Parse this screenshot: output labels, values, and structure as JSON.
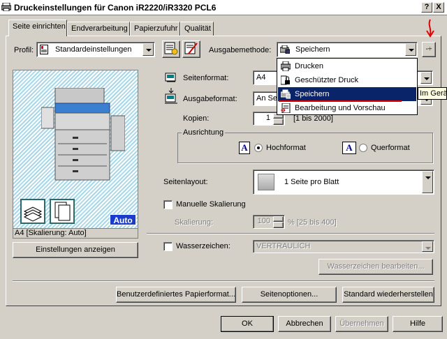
{
  "window": {
    "title": "Druckeinstellungen für Canon iR2220/iR3320 PCL6",
    "help_btn": "?",
    "close_btn": "X"
  },
  "tabs": [
    "Seite einrichten",
    "Endverarbeitung",
    "Papierzufuhr",
    "Qualität"
  ],
  "profil": {
    "label": "Profil:",
    "value": "Standardeinstellungen"
  },
  "ausgabemethode": {
    "label": "Ausgabemethode:",
    "value": "Speichern",
    "side_btn": "-÷"
  },
  "menu": {
    "items": [
      "Drucken",
      "Geschützter Druck",
      "Speichern",
      "Bearbeitung und Vorschau"
    ],
    "selected": "Speichern",
    "tooltip": "Im Gerä"
  },
  "seitenformat": {
    "label": "Seitenformat:",
    "value": "A4"
  },
  "ausgabeformat": {
    "label": "Ausgabeformat:",
    "value": "An Se"
  },
  "kopien": {
    "label": "Kopien:",
    "value": "1",
    "range": "[1 bis 2000]"
  },
  "ausrichtung": {
    "label": "Ausrichtung",
    "hoch": "Hochformat",
    "quer": "Querformat",
    "icon_letter": "A"
  },
  "seitenlayout": {
    "label": "Seitenlayout:",
    "value": "1 Seite pro Blatt"
  },
  "manuelle_skalierung": {
    "label": "Manuelle Skalierung"
  },
  "skalierung": {
    "label": "Skalierung:",
    "value": "100",
    "range": "% [25 bis 400]"
  },
  "wasserzeichen": {
    "label": "Wasserzeichen:",
    "value": "VERTRAULICH",
    "edit_btn": "Wasserzeichen bearbeiten..."
  },
  "preview": {
    "badge": "Auto",
    "caption": "A4 [Skalierung: Auto]",
    "show_btn": "Einstellungen anzeigen"
  },
  "bottom_buttons": {
    "custom_paper": "Benutzerdefiniertes Papierformat...",
    "page_options": "Seitenoptionen...",
    "restore": "Standard wiederherstellen"
  },
  "dialog_buttons": {
    "ok": "OK",
    "cancel": "Abbrechen",
    "apply": "Übernehmen",
    "help": "Hilfe"
  },
  "colors": {
    "selection": "#0a246a",
    "annotation": "#e00000",
    "auto_badge": "#1a3ccc"
  }
}
